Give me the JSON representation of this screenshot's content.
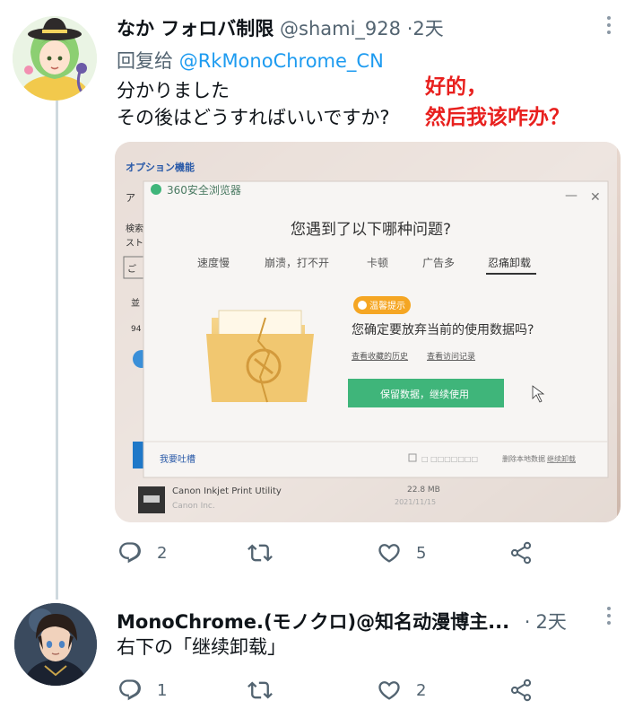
{
  "tweet1": {
    "display_name": "なか フォロバ制限",
    "handle": "@shami_928",
    "separator": "·",
    "time": "2天",
    "reply_prefix": "回复给",
    "reply_mention": "@RkMonoChrome_CN",
    "lines": [
      "分かりました",
      "その後はどうすればいいですか?"
    ],
    "annotation": [
      "好的，",
      "然后我该咋办？"
    ],
    "annotation_color": "#e8201e",
    "actions": {
      "replies": "2",
      "reposts": "",
      "likes": "5"
    },
    "photo": {
      "side_panel": {
        "title": "オプション機能",
        "items": [
          "ア",
          "検索",
          "スト",
          "ご",
          "並",
          "94"
        ]
      },
      "browser_title": "360安全浏览器",
      "question": "您遇到了以下哪种问题?",
      "tabs": [
        "速度慢",
        "崩溃，打不开",
        "卡顿",
        "广告多",
        "忍痛卸载"
      ],
      "selected_tab": "忍痛卸载",
      "badge": "温馨提示",
      "prompt": "您确定要放弃当前的使用数据吗?",
      "links": [
        "查看收藏的历史",
        "查看访问记录"
      ],
      "primary_button": "保留数据，继续使用",
      "feedback": "我要吐槽",
      "footer_options": [
        "删除本地数据",
        "继续卸载"
      ],
      "app_row": {
        "name": "Canon Inkjet Print Utility",
        "publisher": "Canon Inc.",
        "size": "22.8 MB",
        "date": "2021/11/15"
      },
      "accent_color": "#3fb57a"
    }
  },
  "tweet2": {
    "display_name": "MonoChrome.(モノクロ)@知名动漫博主...",
    "separator": "·",
    "time": "2天",
    "text": "右下の「继续卸载」",
    "actions": {
      "replies": "1",
      "reposts": "",
      "likes": "2"
    }
  },
  "colors": {
    "link": "#1d9bf0",
    "muted": "#536471",
    "thread_line": "#cfd9de"
  }
}
